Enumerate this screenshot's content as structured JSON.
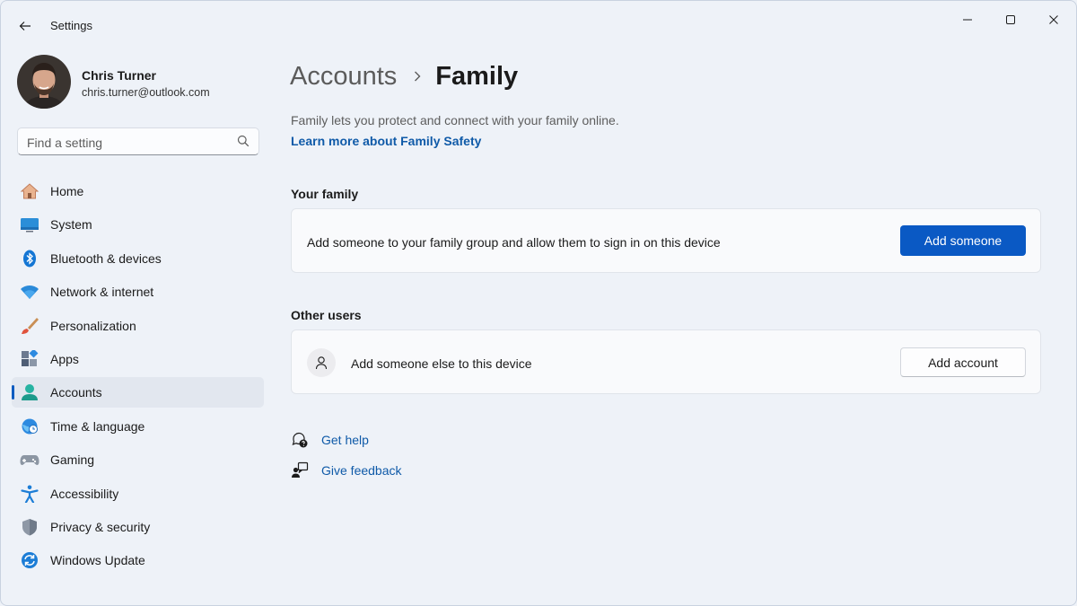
{
  "window": {
    "title": "Settings"
  },
  "user": {
    "name": "Chris Turner",
    "email": "chris.turner@outlook.com"
  },
  "search": {
    "placeholder": "Find a setting"
  },
  "sidebar": {
    "items": [
      {
        "label": "Home",
        "icon": "home-icon",
        "active": false
      },
      {
        "label": "System",
        "icon": "system-icon",
        "active": false
      },
      {
        "label": "Bluetooth & devices",
        "icon": "bluetooth-icon",
        "active": false
      },
      {
        "label": "Network & internet",
        "icon": "wifi-icon",
        "active": false
      },
      {
        "label": "Personalization",
        "icon": "brush-icon",
        "active": false
      },
      {
        "label": "Apps",
        "icon": "apps-icon",
        "active": false
      },
      {
        "label": "Accounts",
        "icon": "accounts-icon",
        "active": true
      },
      {
        "label": "Time & language",
        "icon": "globe-clock-icon",
        "active": false
      },
      {
        "label": "Gaming",
        "icon": "gamepad-icon",
        "active": false
      },
      {
        "label": "Accessibility",
        "icon": "accessibility-icon",
        "active": false
      },
      {
        "label": "Privacy & security",
        "icon": "shield-icon",
        "active": false
      },
      {
        "label": "Windows Update",
        "icon": "update-icon",
        "active": false
      }
    ]
  },
  "breadcrumb": {
    "parent": "Accounts",
    "current": "Family"
  },
  "main": {
    "description": "Family lets you protect and connect with your family online.",
    "learn_more": "Learn more about Family Safety",
    "your_family": {
      "heading": "Your family",
      "text": "Add someone to your family group and allow them to sign in on this device",
      "button": "Add someone"
    },
    "other_users": {
      "heading": "Other users",
      "text": "Add someone else to this device",
      "button": "Add account"
    },
    "help": {
      "get_help": "Get help",
      "give_feedback": "Give feedback"
    }
  },
  "colors": {
    "accent": "#0a59c4",
    "link": "#0f5aa8",
    "background": "#eef2f8"
  }
}
